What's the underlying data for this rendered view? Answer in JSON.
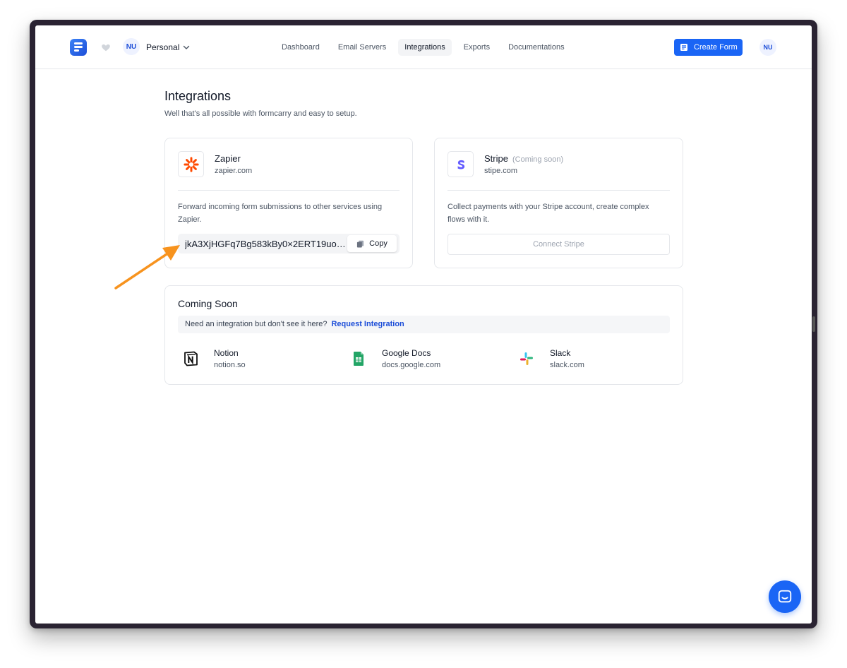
{
  "workspace": {
    "avatar_initials": "NU",
    "name": "Personal"
  },
  "nav": [
    {
      "label": "Dashboard",
      "active": false
    },
    {
      "label": "Email Servers",
      "active": false
    },
    {
      "label": "Integrations",
      "active": true
    },
    {
      "label": "Exports",
      "active": false
    },
    {
      "label": "Documentations",
      "active": false
    }
  ],
  "header": {
    "create_label": "Create Form",
    "user_initials": "NU"
  },
  "page": {
    "title": "Integrations",
    "subtitle": "Well that's all possible with formcarry and easy to setup."
  },
  "zapier": {
    "name": "Zapier",
    "url": "zapier.com",
    "description": "Forward incoming form submissions to other services using Zapier.",
    "api_key": "jkA3XjHGFq7Bg583kBy0×2ERT19uor...",
    "copy_label": "Copy"
  },
  "stripe": {
    "name": "Stripe",
    "tag": "(Coming soon)",
    "url": "stipe.com",
    "description": "Collect payments with your Stripe account, create complex flows with it.",
    "connect_label": "Connect Stripe"
  },
  "coming_soon": {
    "title": "Coming Soon",
    "banner_text": "Need an integration but don't see it here?",
    "banner_link": "Request Integration",
    "items": [
      {
        "name": "Notion",
        "url": "notion.so",
        "icon": "notion-icon"
      },
      {
        "name": "Google Docs",
        "url": "docs.google.com",
        "icon": "google-docs-icon"
      },
      {
        "name": "Slack",
        "url": "slack.com",
        "icon": "slack-icon"
      }
    ]
  },
  "colors": {
    "primary": "#1a65f5",
    "zapier": "#ff4a00",
    "stripe": "#635bff",
    "arrow": "#f7931e"
  }
}
